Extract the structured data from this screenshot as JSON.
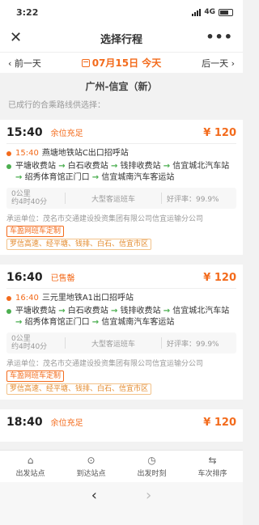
{
  "statusbar": {
    "time": "3:22",
    "network": "4G"
  },
  "nav": {
    "title": "选择行程",
    "close_icon": "✕",
    "more_icon": "•••"
  },
  "datebar": {
    "prev_label": "前一天",
    "date_label": "07月15日 今天",
    "next_label": "后一天"
  },
  "route": {
    "title": "广州-信宜（新）",
    "subtitle": "已成行的合乘路线供选择："
  },
  "trips": [
    {
      "time": "15:40",
      "status": "余位充足",
      "price": "¥ 120",
      "dep_time": "15:40",
      "dep_station": "燕塘地铁站C出口招呼站",
      "stops_1": "平塘收费站",
      "stops_2": "白石收费站",
      "stops_3": "钱排收费站",
      "stops_4": "信宜城北汽车站",
      "stops_5": "绍秀体育馆正门口",
      "stops_6": "信宜城南汽车客运站",
      "distance": "0公里",
      "duration": "约4时40分",
      "vehicle": "大型客运班车",
      "rating": "好评率：99.9%",
      "carrier": "承运单位：茂名市交通建设投资集团有限公司信宜运输分公司",
      "tag1": "车盈网班车定制",
      "tag2": "罗信高速、经平塘、钱排、白石、信宜市区"
    },
    {
      "time": "16:40",
      "status": "已售罄",
      "price": "¥ 120",
      "dep_time": "16:40",
      "dep_station": "三元里地铁A1出口招呼站",
      "stops_1": "平塘收费站",
      "stops_2": "白石收费站",
      "stops_3": "钱排收费站",
      "stops_4": "信宜城北汽车站",
      "stops_5": "绍秀体育馆正门口",
      "stops_6": "信宜城南汽车客运站",
      "distance": "0公里",
      "duration": "约4时40分",
      "vehicle": "大型客运班车",
      "rating": "好评率：99.9%",
      "carrier": "承运单位：茂名市交通建设投资集团有限公司信宜运输分公司",
      "tag1": "车盈网班车定制",
      "tag2": "罗信高速、经平塘、钱排、白石、信宜市区"
    },
    {
      "time": "18:40",
      "status": "余位充足",
      "price": "¥ 120"
    }
  ],
  "tabs": [
    {
      "label": "出发站点",
      "icon": "home-icon"
    },
    {
      "label": "到达站点",
      "icon": "location-pin-icon"
    },
    {
      "label": "出发时刻",
      "icon": "clock-icon"
    },
    {
      "label": "车次排序",
      "icon": "sort-icon"
    }
  ],
  "colors": {
    "accent": "#f36b1c",
    "green": "#4caf50"
  }
}
